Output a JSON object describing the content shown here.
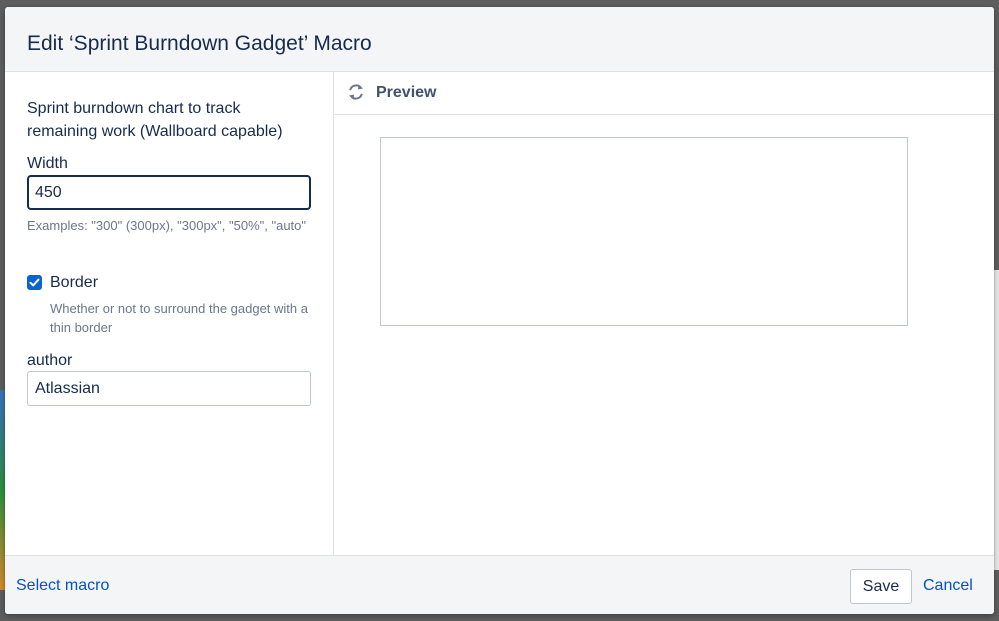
{
  "dialog": {
    "title": "Edit ‘Sprint Burndown Gadget’ Macro"
  },
  "left_panel": {
    "description": "Sprint burndown chart to track remaining work (Wallboard capable)",
    "width": {
      "label": "Width",
      "value": "450",
      "help": "Examples: \"300\" (300px), \"300px\", \"50%\", \"auto\""
    },
    "border": {
      "label": "Border",
      "checked": true,
      "help": "Whether or not to surround the gadget with a thin border"
    },
    "author": {
      "label": "author",
      "value": "Atlassian"
    }
  },
  "preview": {
    "label": "Preview",
    "icon": "refresh-icon"
  },
  "footer": {
    "select_macro": "Select macro",
    "save": "Save",
    "cancel": "Cancel"
  },
  "colors": {
    "link": "#0052cc",
    "checkbox": "#0b63ce",
    "header_bg": "#f4f5f7",
    "text": "#172b4d"
  }
}
